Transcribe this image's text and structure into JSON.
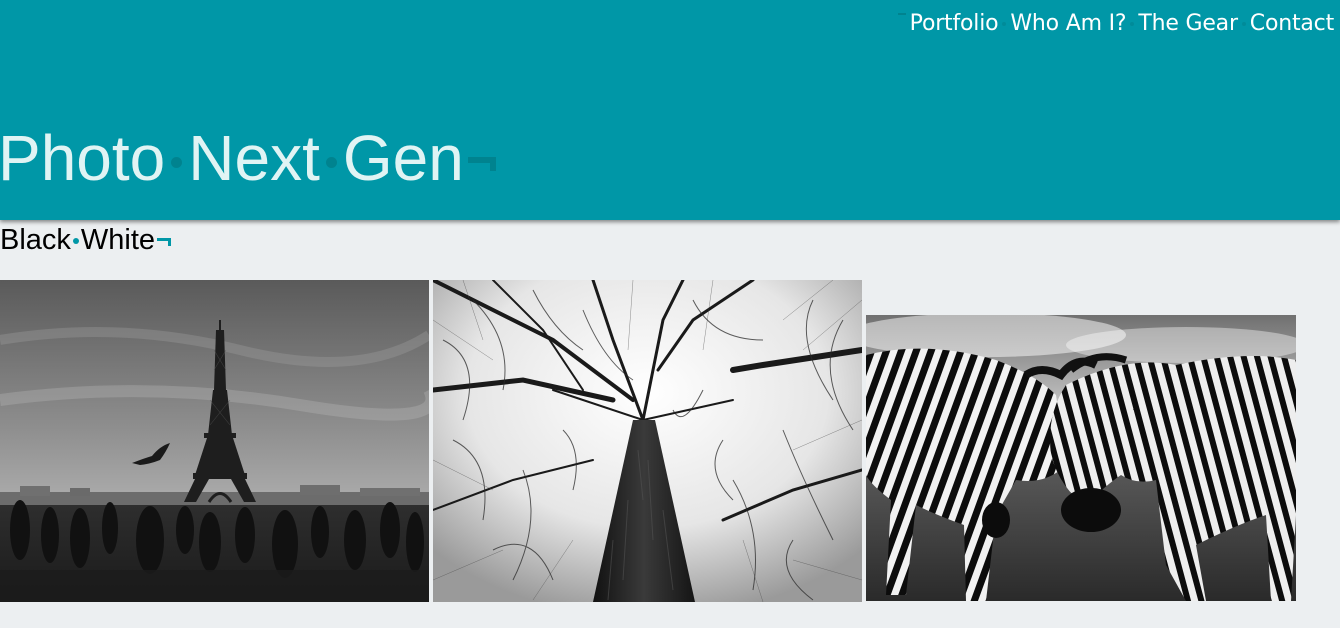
{
  "nav": {
    "items": [
      {
        "label": "Portfolio"
      },
      {
        "label": "Who Am I?"
      },
      {
        "label": "The Gear"
      },
      {
        "label": "Contact"
      }
    ]
  },
  "site": {
    "title_words": [
      "Photo",
      "Next",
      "Gen"
    ]
  },
  "section": {
    "title_words": [
      "Black",
      "White"
    ]
  },
  "gallery": {
    "photos": [
      {
        "subject": "eiffel-tower"
      },
      {
        "subject": "tree-canopy"
      },
      {
        "subject": "zebras"
      }
    ]
  },
  "colors": {
    "header_bg": "#0097a7",
    "page_bg": "#eceff1",
    "accent_dark": "#00838f"
  }
}
